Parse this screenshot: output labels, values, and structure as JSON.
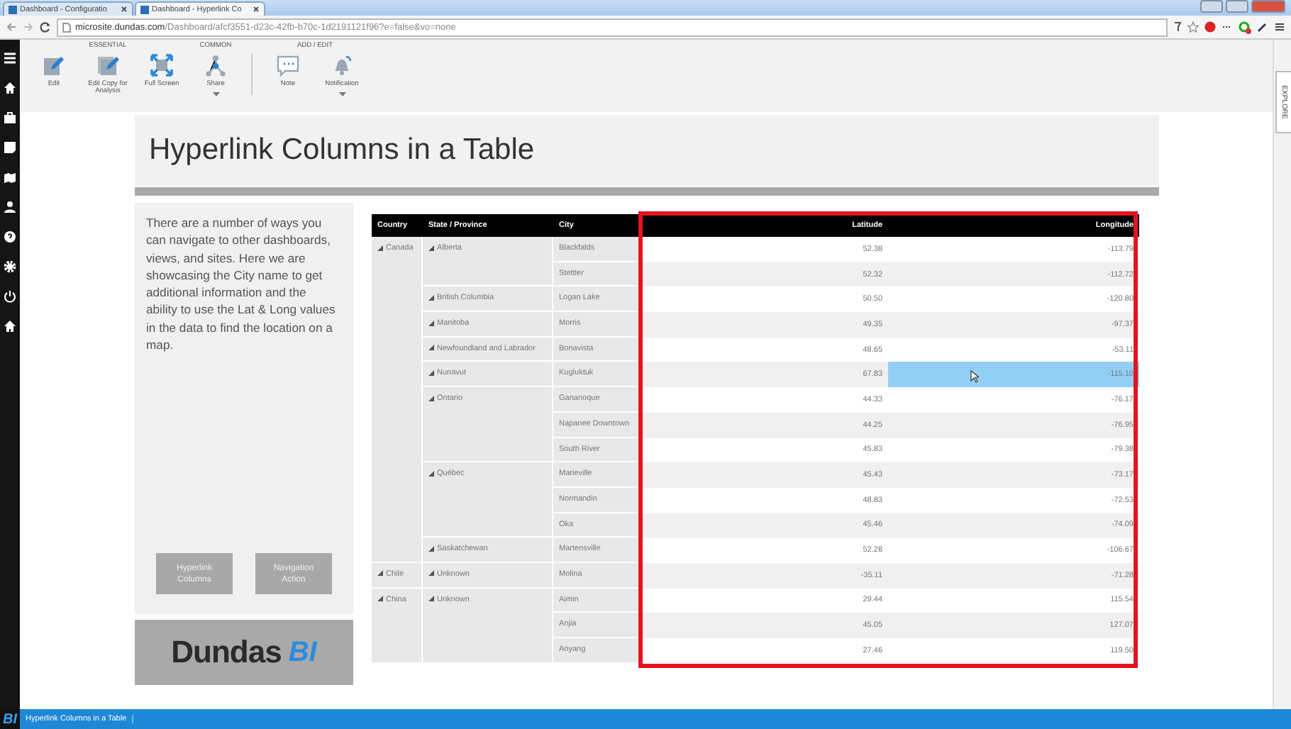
{
  "browser": {
    "tabs": [
      {
        "label": "Dashboard - Configuratio",
        "selected": false
      },
      {
        "label": "Dashboard - Hyperlink Co",
        "selected": true
      }
    ],
    "url": {
      "host": "microsite.dundas.com",
      "path": "/Dashboard/afcf3551-d23c-42fb-b70c-1d2191121f96?e=false&vo=none"
    }
  },
  "toolbar": {
    "groups": [
      {
        "label": "ESSENTIAL",
        "items": [
          {
            "label": "Edit",
            "kind": "edit",
            "dropdown": false
          },
          {
            "label": "Edit Copy for Analysis",
            "kind": "edit-copy",
            "dropdown": false
          },
          {
            "label": "Full Screen",
            "kind": "fullscreen",
            "dropdown": false
          }
        ]
      },
      {
        "label": "COMMON",
        "items": [
          {
            "label": "Share",
            "kind": "share",
            "dropdown": true
          }
        ]
      },
      {
        "label": "ADD / EDIT",
        "items": [
          {
            "label": "Note",
            "kind": "note",
            "dropdown": false
          },
          {
            "label": "Notification",
            "kind": "notification",
            "dropdown": true
          }
        ]
      }
    ]
  },
  "side_tab": "EXPLORE",
  "title": "Hyperlink Columns in a Table",
  "description": "There are a number of ways you can navigate to other dashboards, views, and sites. Here we are showcasing the City name to get additional information and the ability to use the Lat & Long values in the data to find the location on a map.",
  "nav_buttons": [
    "Hyperlink Columns",
    "Navigation Action"
  ],
  "logo": {
    "word": "Dundas",
    "mark": "BI"
  },
  "table": {
    "columns": [
      "Country",
      "State / Province",
      "City",
      "Latitude",
      "Longitude"
    ],
    "countries": [
      {
        "name": "Canada",
        "expanded": true,
        "states": [
          {
            "name": "Alberta",
            "expanded": true,
            "cities": [
              {
                "name": "Blackfalds",
                "latitude": "52.38",
                "longitude": "-113.79",
                "selected": false
              },
              {
                "name": "Stettler",
                "latitude": "52.32",
                "longitude": "-112.72",
                "selected": false
              }
            ]
          },
          {
            "name": "British Columbia",
            "expanded": true,
            "cities": [
              {
                "name": "Logan Lake",
                "latitude": "50.50",
                "longitude": "-120.80",
                "selected": false
              }
            ]
          },
          {
            "name": "Manitoba",
            "expanded": true,
            "cities": [
              {
                "name": "Morris",
                "latitude": "49.35",
                "longitude": "-97.37",
                "selected": false
              }
            ]
          },
          {
            "name": "Newfoundland and Labrador",
            "expanded": true,
            "cities": [
              {
                "name": "Bonavista",
                "latitude": "48.65",
                "longitude": "-53.11",
                "selected": false
              }
            ]
          },
          {
            "name": "Nunavut",
            "expanded": true,
            "cities": [
              {
                "name": "Kugluktuk",
                "latitude": "67.83",
                "longitude": "-115.10",
                "selected": true
              }
            ]
          },
          {
            "name": "Ontario",
            "expanded": true,
            "cities": [
              {
                "name": "Gananoque",
                "latitude": "44.33",
                "longitude": "-76.17",
                "selected": false
              },
              {
                "name": "Napanee Downtown",
                "latitude": "44.25",
                "longitude": "-76.95",
                "selected": false
              },
              {
                "name": "South River",
                "latitude": "45.83",
                "longitude": "-79.38",
                "selected": false
              }
            ]
          },
          {
            "name": "Québec",
            "expanded": true,
            "cities": [
              {
                "name": "Marieville",
                "latitude": "45.43",
                "longitude": "-73.17",
                "selected": false
              },
              {
                "name": "Normandin",
                "latitude": "48.83",
                "longitude": "-72.53",
                "selected": false
              },
              {
                "name": "Oka",
                "latitude": "45.46",
                "longitude": "-74.09",
                "selected": false
              }
            ]
          },
          {
            "name": "Saskatchewan",
            "expanded": true,
            "cities": [
              {
                "name": "Martensville",
                "latitude": "52.28",
                "longitude": "-106.67",
                "selected": false
              }
            ]
          }
        ]
      },
      {
        "name": "Chile",
        "expanded": true,
        "states": [
          {
            "name": "Unknown",
            "expanded": true,
            "cities": [
              {
                "name": "Molina",
                "latitude": "-35.11",
                "longitude": "-71.28",
                "selected": false
              }
            ]
          }
        ]
      },
      {
        "name": "China",
        "expanded": true,
        "states": [
          {
            "name": "Unknown",
            "expanded": true,
            "cities": [
              {
                "name": "Aimin",
                "latitude": "29.44",
                "longitude": "115.54",
                "selected": false
              },
              {
                "name": "Anjia",
                "latitude": "45.05",
                "longitude": "127.07",
                "selected": false
              },
              {
                "name": "Aoyang",
                "latitude": "27.46",
                "longitude": "119.50",
                "selected": false
              }
            ]
          }
        ]
      }
    ]
  },
  "status_bar": {
    "logo": "BI",
    "title": "Hyperlink Columns in a Table"
  }
}
